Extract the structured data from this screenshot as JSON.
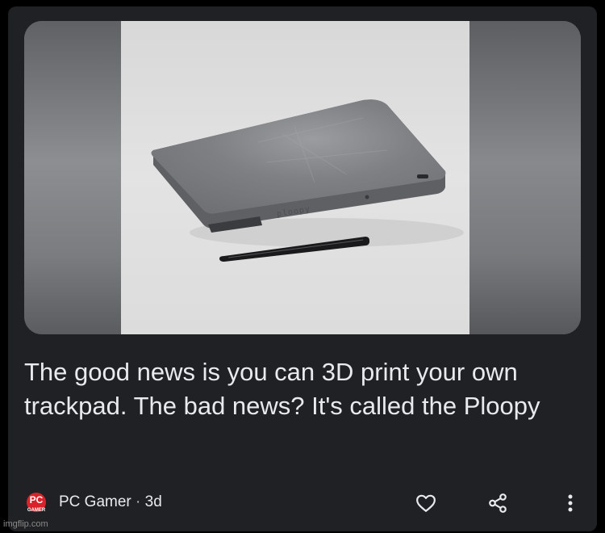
{
  "article": {
    "headline": "The good news is you can 3D print your own trackpad. The bad news? It's called the Ploopy",
    "image_device_label": "ploopy"
  },
  "footer": {
    "publisher_logo_text": "PC",
    "publisher_logo_subtext": "GAMER",
    "publisher": "PC Gamer",
    "separator": "·",
    "age": "3d"
  },
  "watermark": "imgflip.com",
  "icons": {
    "like": "heart-icon",
    "share": "share-icon",
    "more": "more-vert-icon"
  },
  "colors": {
    "card_bg": "#202124",
    "text_primary": "#e8eaed",
    "logo_red": "#d8232a"
  }
}
